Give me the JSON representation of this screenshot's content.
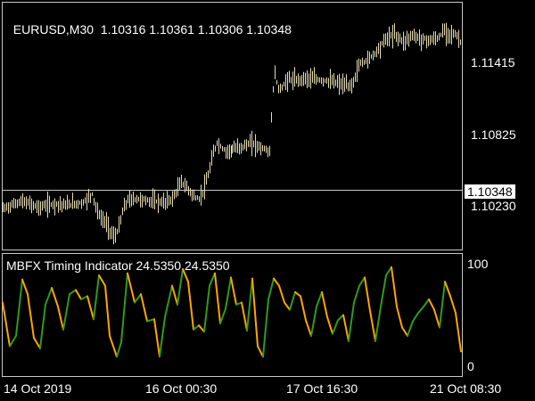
{
  "main": {
    "symbol": "EURUSD,M30",
    "ohlc": "1.10316 1.10361 1.10306 1.10348",
    "current_price": "1.10348",
    "y_ticks": [
      "1.11415",
      "1.10825",
      "1.10230"
    ]
  },
  "indicator": {
    "title": "MBFX Timing Indicator 24.5350 24.5350",
    "y_ticks": [
      "100",
      "0"
    ]
  },
  "x_ticks": [
    "14 Oct 2019",
    "16 Oct 00:30",
    "17 Oct 16:30",
    "21 Oct 08:30"
  ],
  "colors": {
    "background": "#000000",
    "bars": "#E6DCB4",
    "frame": "#C8C8C8",
    "price_line": "#C8C8C8",
    "osc_up": "#2E9B1E",
    "osc_down": "#FFA500"
  },
  "chart_data": [
    {
      "type": "line",
      "title": "EURUSD,M30",
      "x": [
        0,
        10,
        20,
        30,
        40,
        50,
        60,
        70,
        80,
        90,
        100,
        105,
        110,
        115,
        120,
        125,
        130,
        135,
        140,
        150,
        160,
        170,
        180,
        190,
        200,
        205,
        210,
        215,
        220,
        225,
        230,
        235,
        240,
        245,
        250,
        260,
        270,
        280,
        290,
        300,
        305,
        310,
        315,
        320,
        330,
        340,
        350,
        360,
        370,
        380,
        390,
        395,
        400,
        410,
        420,
        430,
        440,
        450,
        460,
        470,
        480,
        490,
        495,
        500,
        510,
        515
      ],
      "y": [
        1.1019,
        1.1022,
        1.1025,
        1.1023,
        1.102,
        1.1022,
        1.1023,
        1.1022,
        1.1023,
        1.1024,
        1.1031,
        1.1018,
        1.1011,
        1.1008,
        1.1001,
        1.0995,
        1.1004,
        1.1019,
        1.1026,
        1.1027,
        1.1026,
        1.1025,
        1.1024,
        1.1027,
        1.1041,
        1.1037,
        1.1033,
        1.1028,
        1.1027,
        1.1034,
        1.1046,
        1.1062,
        1.1073,
        1.1069,
        1.1066,
        1.1068,
        1.107,
        1.1073,
        1.1069,
        1.1066,
        1.1131,
        1.1117,
        1.1119,
        1.1125,
        1.1124,
        1.1126,
        1.1125,
        1.1124,
        1.1123,
        1.1121,
        1.1119,
        1.1124,
        1.1137,
        1.1141,
        1.1148,
        1.1158,
        1.1162,
        1.1156,
        1.1161,
        1.1158,
        1.1157,
        1.1159,
        1.1165,
        1.1163,
        1.1161,
        1.1154
      ],
      "ylim": [
        1.0987,
        1.1187
      ],
      "current_price": 1.10348
    },
    {
      "type": "line",
      "title": "MBFX Timing Indicator 24.5350 24.5350",
      "x": [
        0,
        8,
        15,
        22,
        28,
        35,
        42,
        48,
        55,
        62,
        68,
        75,
        82,
        88,
        95,
        102,
        108,
        115,
        120,
        128,
        133,
        140,
        148,
        155,
        162,
        170,
        176,
        182,
        190,
        196,
        202,
        208,
        214,
        220,
        226,
        232,
        238,
        244,
        250,
        256,
        262,
        268,
        274,
        280,
        286,
        292,
        298,
        304,
        310,
        316,
        322,
        328,
        334,
        340,
        346,
        352,
        358,
        364,
        370,
        376,
        382,
        388,
        394,
        400,
        406,
        412,
        418,
        424,
        430,
        436,
        442,
        448,
        454,
        460,
        466,
        472,
        478,
        484,
        490,
        496,
        502,
        508,
        514
      ],
      "y": [
        62,
        20,
        30,
        84,
        70,
        28,
        18,
        60,
        76,
        58,
        36,
        70,
        74,
        65,
        68,
        46,
        88,
        78,
        30,
        10,
        24,
        90,
        62,
        70,
        44,
        46,
        10,
        48,
        78,
        60,
        94,
        82,
        36,
        40,
        34,
        78,
        90,
        42,
        56,
        86,
        60,
        62,
        35,
        85,
        20,
        10,
        65,
        85,
        78,
        62,
        55,
        72,
        68,
        45,
        30,
        58,
        72,
        48,
        32,
        45,
        50,
        25,
        62,
        78,
        86,
        54,
        25,
        58,
        88,
        96,
        58,
        38,
        30,
        44,
        52,
        58,
        65,
        55,
        38,
        82,
        68,
        52,
        15
      ],
      "ylim": [
        0,
        100
      ],
      "y_ticks": [
        100,
        0
      ],
      "up_segments_color": "green",
      "down_segments_color": "orange"
    }
  ]
}
